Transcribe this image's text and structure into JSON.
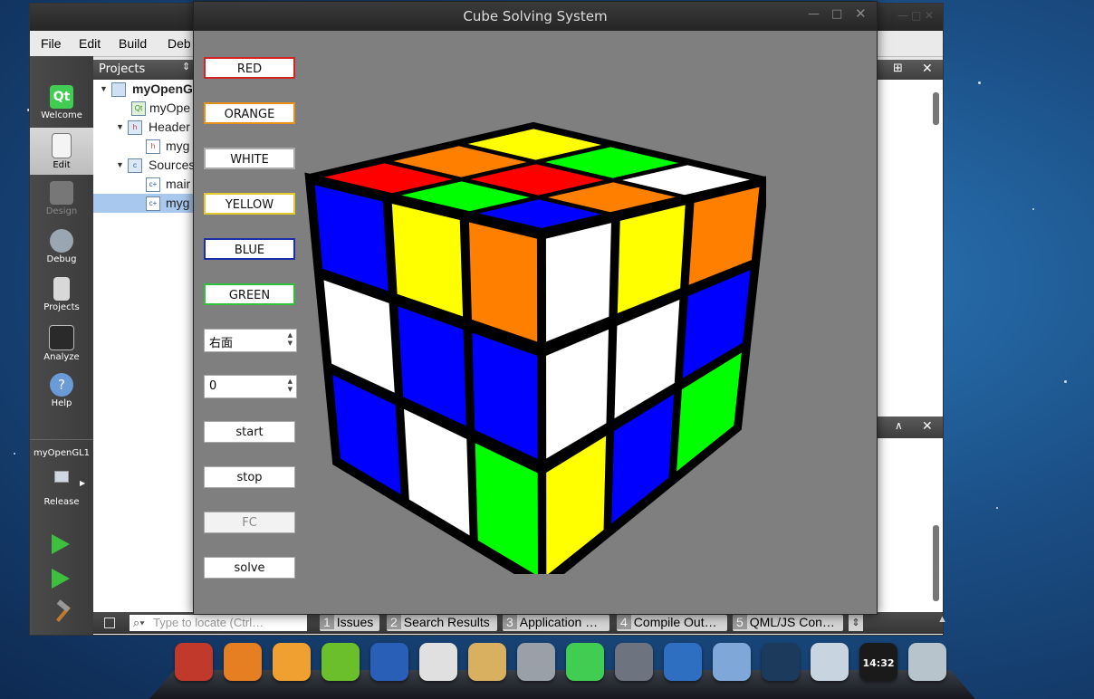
{
  "qt_creator": {
    "menu": {
      "file": "File",
      "edit": "Edit",
      "build": "Build",
      "debug": "Deb"
    },
    "modes": [
      {
        "label": "Welcome",
        "icon": "qt-logo-icon"
      },
      {
        "label": "Edit",
        "icon": "document-edit-icon"
      },
      {
        "label": "Design",
        "icon": "design-icon"
      },
      {
        "label": "Debug",
        "icon": "bug-icon"
      },
      {
        "label": "Projects",
        "icon": "projects-icon"
      },
      {
        "label": "Analyze",
        "icon": "analyze-icon"
      },
      {
        "label": "Help",
        "icon": "help-icon"
      }
    ],
    "project_target": "myOpenGL1",
    "build_config": "Release",
    "projects_header": "Projects",
    "tree": [
      {
        "label": "myOpenG"
      },
      {
        "label": "myOpe"
      },
      {
        "label": "Header"
      },
      {
        "label": "myg"
      },
      {
        "label": "Sources"
      },
      {
        "label": "mair"
      },
      {
        "label": "myg"
      }
    ],
    "locate_placeholder": "Type to locate (Ctrl…",
    "output_tabs": [
      {
        "num": "1",
        "label": "Issues"
      },
      {
        "num": "2",
        "label": "Search Results"
      },
      {
        "num": "3",
        "label": "Application …"
      },
      {
        "num": "4",
        "label": "Compile Out…"
      },
      {
        "num": "5",
        "label": "QML/JS Con…"
      }
    ]
  },
  "cube_window": {
    "title": "Cube Solving System",
    "color_buttons": [
      {
        "label": "RED",
        "border": "#d22424"
      },
      {
        "label": "ORANGE",
        "border": "#e8901c"
      },
      {
        "label": "WHITE",
        "border": "#aaaaaa"
      },
      {
        "label": "YELLOW",
        "border": "#e3c92a"
      },
      {
        "label": "BLUE",
        "border": "#1c2fa8"
      },
      {
        "label": "GREEN",
        "border": "#2fc03a"
      }
    ],
    "face_select": "右面",
    "step_spin": "0",
    "start_label": "start",
    "stop_label": "stop",
    "fc_label": "FC",
    "solve_label": "solve",
    "cube_colors": {
      "R": "#ff0000",
      "O": "#ff8000",
      "W": "#ffffff",
      "Y": "#ffff00",
      "B": "#0000ff",
      "G": "#00ff00"
    },
    "cube_faces": {
      "top": [
        "Y",
        "G",
        "W",
        "O",
        "R",
        "O",
        "R",
        "G",
        "B"
      ],
      "left": [
        "B",
        "Y",
        "O",
        "W",
        "B",
        "B",
        "B",
        "W",
        "G"
      ],
      "right": [
        "W",
        "Y",
        "O",
        "W",
        "W",
        "B",
        "Y",
        "B",
        "G"
      ]
    }
  },
  "dock_apps": [
    {
      "name": "rocket-app-icon",
      "color": "#c0392b"
    },
    {
      "name": "store-app-icon",
      "color": "#e67e22"
    },
    {
      "name": "swirl-app-icon",
      "color": "#f0a030"
    },
    {
      "name": "music-app-icon",
      "color": "#6bbf2a"
    },
    {
      "name": "globe-app-icon",
      "color": "#2a5fb8"
    },
    {
      "name": "chrome-icon",
      "color": "#e0e0e0"
    },
    {
      "name": "mail-app-icon",
      "color": "#d8b060"
    },
    {
      "name": "settings-wheel-icon",
      "color": "#9aa0a8"
    },
    {
      "name": "qt-creator-icon",
      "color": "#41cd52"
    },
    {
      "name": "system-settings-icon",
      "color": "#6d7480"
    },
    {
      "name": "browser-globe-icon",
      "color": "#2e6fc2"
    },
    {
      "name": "drive-app-icon",
      "color": "#7fa8d8"
    },
    {
      "name": "power-ring-icon",
      "color": "#1c3a5c"
    },
    {
      "name": "pen-app-icon",
      "color": "#c8d4e0"
    },
    {
      "name": "clock-app-icon",
      "color": "#1a1a1a"
    },
    {
      "name": "trash-icon",
      "color": "#b8c4cc"
    }
  ],
  "clock_text": "14:32"
}
